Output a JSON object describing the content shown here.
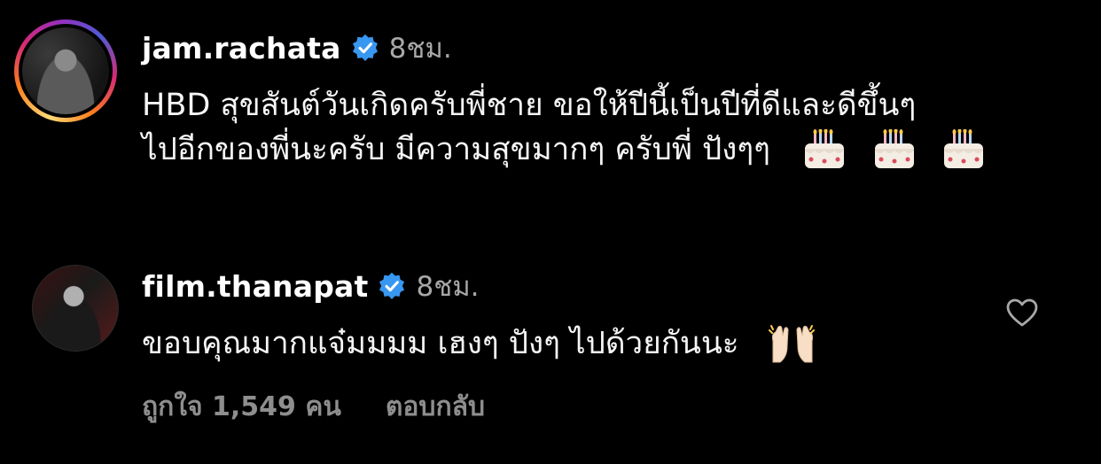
{
  "comments": [
    {
      "username": "jam.rachata",
      "verified": true,
      "timestamp": "8ชม.",
      "text_line_1": "HBD สุขสันต์วันเกิดครับพี่ชาย ขอให้ปีนี้เป็นปีที่ดีและดีขึ้นๆ",
      "text_line_2": "ไปอีกของพี่นะครับ มีความสุขมากๆ ครับพี่ ปังๆๆ",
      "emojis": [
        "birthday-cake",
        "birthday-cake",
        "birthday-cake"
      ],
      "has_story_ring": true
    },
    {
      "username": "film.thanapat",
      "verified": true,
      "timestamp": "8ชม.",
      "text": "ขอบคุณมากแจ๋มมมม เฮงๆ ปังๆ ไปด้วยกันนะ",
      "emojis": [
        "raising-hands"
      ],
      "likes_label": "ถูกใจ 1,549 คน",
      "reply_label": "ตอบกลับ"
    }
  ],
  "colors": {
    "background": "#000000",
    "text": "#f5f5f5",
    "muted": "#a8a8a8",
    "verified_blue": "#3897f0"
  }
}
